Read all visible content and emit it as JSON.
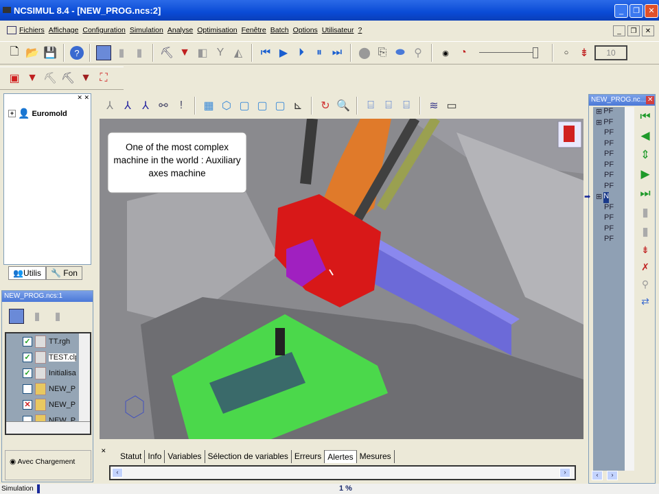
{
  "window": {
    "title": "NCSIMUL 8.4 - [NEW_PROG.ncs:2]"
  },
  "menu": [
    "Fichiers",
    "Affichage",
    "Configuration",
    "Simulation",
    "Analyse",
    "Optimisation",
    "Fenêtre",
    "Batch",
    "Options",
    "Utilisateur",
    "?"
  ],
  "toolbar": {
    "speed_value": "10",
    "play_mode": "speed-radio-selected"
  },
  "tree": {
    "root": "Euromold",
    "tabs": [
      "Utilis",
      "Fon"
    ]
  },
  "left_lower": {
    "title": "NEW_PROG.ncs:1",
    "items": [
      {
        "label": "TT.rgh",
        "check": "checked"
      },
      {
        "label": "TEST.clp",
        "check": "checked"
      },
      {
        "label": "Initialisation",
        "check": "checked"
      },
      {
        "label": "NEW_PROG",
        "check": "unchecked"
      },
      {
        "label": "NEW_PROG",
        "check": "crossed"
      },
      {
        "label": "NEW_PROG",
        "check": "unchecked"
      }
    ],
    "radio_label": "Avec Chargement"
  },
  "viewport": {
    "callout": "One of the most complex machine in the world : Auxiliary axes machine"
  },
  "bottom_tabs": [
    "Statut",
    "Info",
    "Variables",
    "Sélection de variables",
    "Erreurs",
    "Alertes",
    "Mesures"
  ],
  "bottom_active_tab": "Alertes",
  "right_panel": {
    "title": "NEW_PROG.nc...",
    "rows": [
      "PF",
      "PF",
      "PF",
      "PF",
      "PF",
      "PF",
      "PF",
      "PF",
      "N",
      "PF",
      "PF",
      "PF",
      "PF"
    ],
    "current_row": 8
  },
  "status": {
    "mode": "Simulation",
    "progress": "1 %",
    "progress_fraction": 0.01
  },
  "colors": {
    "titlebar": "#0a4bd6",
    "play": "#1a5fd0",
    "nav_green": "#1f9a2a"
  }
}
